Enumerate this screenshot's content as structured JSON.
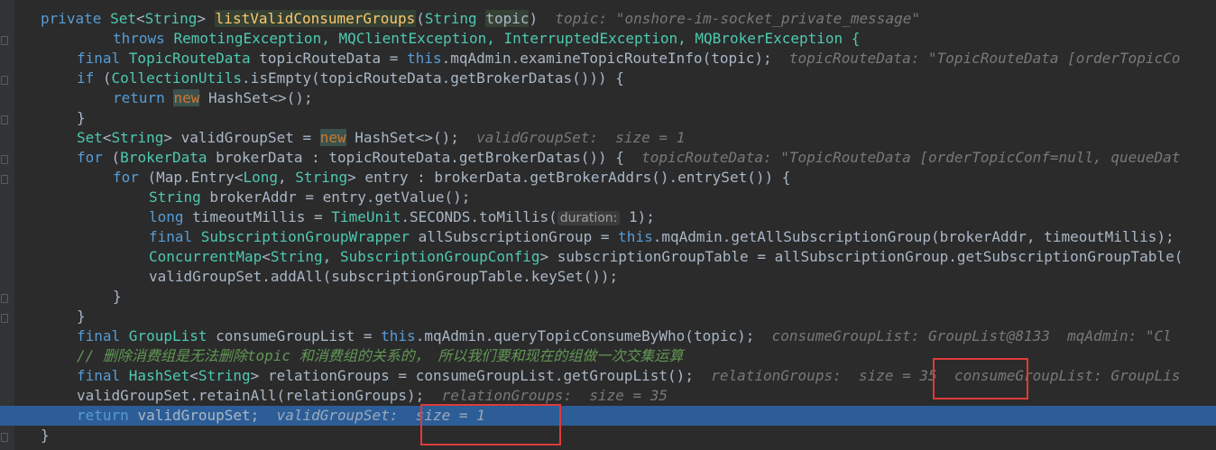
{
  "code": {
    "l1_private": "private ",
    "l1_set": "Set",
    "l1_lt": "<",
    "l1_string": "String",
    "l1_gt": "> ",
    "l1_method": "listValidConsumerGroups",
    "l1_paren": "(",
    "l1_ptype": "String",
    "l1_sp": " ",
    "l1_pname": "topic",
    "l1_close": ")",
    "l1_inlay": "topic: \"onshore-im-socket_private_message\"",
    "l2_throws": "throws ",
    "l2_ex": "RemotingException, MQClientException, InterruptedException, MQBrokerException {",
    "l3_final": "final ",
    "l3_type": "TopicRouteData",
    "l3_rest1": " topicRouteData = ",
    "l3_this": "this",
    "l3_rest2": ".mqAdmin.examineTopicRouteInfo(topic);",
    "l3_inlay": "topicRouteData: \"TopicRouteData [orderTopicCo",
    "l4_if": "if ",
    "l4_p": "(",
    "l4_utils": "CollectionUtils",
    "l4_rest": ".isEmpty(topicRouteData.getBrokerDatas())) {",
    "l5_return": "return ",
    "l5_new": "new",
    "l5_rest": " HashSet<>();",
    "l6": "}",
    "l7_set": "Set",
    "l7_lt": "<",
    "l7_string": "String",
    "l7_rest": "> validGroupSet = ",
    "l7_new": "new",
    "l7_rest2": " HashSet<>();",
    "l7_inlay": "validGroupSet:  size = 1",
    "l8_for": "for ",
    "l8_p": "(",
    "l8_type": "BrokerData",
    "l8_rest": " brokerData : topicRouteData.getBrokerDatas()) {",
    "l8_inlay": "topicRouteData: \"TopicRouteData [orderTopicConf=null, queueDat",
    "l9_for": "for ",
    "l9_rest1": "(Map.Entry<",
    "l9_long": "Long",
    "l9_comma": ", ",
    "l9_string": "String",
    "l9_rest2": "> entry : brokerData.getBrokerAddrs().entrySet()) {",
    "l10_type": "String",
    "l10_rest": " brokerAddr = entry.getValue();",
    "l11_long": "long ",
    "l11_rest": "timeoutMillis = ",
    "l11_tu": "TimeUnit",
    "l11_rest2": ".SECONDS.toMillis(",
    "l11_hint": "duration:",
    "l11_rest3": " 1);",
    "l12_final": "final ",
    "l12_type": "SubscriptionGroupWrapper",
    "l12_rest": " allSubscriptionGroup = ",
    "l12_this": "this",
    "l12_rest2": ".mqAdmin.getAllSubscriptionGroup(brokerAddr, timeoutMillis);",
    "l13_type": "ConcurrentMap",
    "l13_lt": "<",
    "l13_string": "String",
    "l13_comma": ", ",
    "l13_type2": "SubscriptionGroupConfig",
    "l13_rest": "> subscriptionGroupTable = allSubscriptionGroup.getSubscriptionGroupTable(",
    "l14": "validGroupSet.addAll(subscriptionGroupTable.keySet());",
    "l15": "}",
    "l16": "}",
    "l17_final": "final ",
    "l17_type": "GroupList",
    "l17_rest": " consumeGroupList = ",
    "l17_this": "this",
    "l17_rest2": ".mqAdmin.queryTopicConsumeByWho(topic);",
    "l17_inlay": "consumeGroupList: GroupList@8133  mqAdmin: \"Cl",
    "l18_comment": "// 删除消费组是无法删除topic 和消费组的关系的， 所以我们要和现在的组做一次交集运算",
    "l19_final": "final ",
    "l19_type": "HashSet",
    "l19_lt": "<",
    "l19_string": "String",
    "l19_rest": "> relationGroups = consumeGroupList.getGroupList();",
    "l19_inlay": "relationGroups:  size = 35  consumeGroupList: GroupLis",
    "l20": "validGroupSet.retainAll(relationGroups);",
    "l20_inlay": "relationGroups:  size = 35",
    "l21_return": "return ",
    "l21_rest": "validGroupSet;",
    "l21_inlay": "validGroupSet:  size = 1",
    "l22": "}"
  },
  "colors": {
    "background": "#2b2b2b",
    "current_line": "#2d5d97",
    "keyword": "#cc7832",
    "type": "#4ec9b0",
    "highlight_box": "#e03a3a"
  }
}
